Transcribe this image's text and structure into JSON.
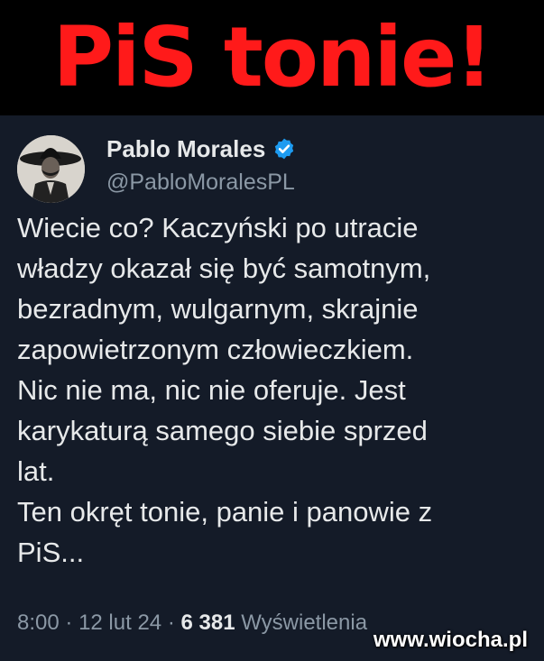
{
  "headline": "PiS tonie!",
  "tweet": {
    "author_name": "Pablo Morales",
    "handle": "@PabloMoralesPL",
    "lines": [
      "Wiecie co? Kaczyński po utracie",
      "władzy okazał się być samotnym,",
      "bezradnym, wulgarnym, skrajnie",
      "zapowietrzonym człowieczkiem.",
      "Nic nie ma, nic nie oferuje. Jest",
      "karykaturą samego siebie sprzed",
      "lat.",
      "Ten okręt tonie, panie i panowie z",
      "PiS..."
    ],
    "time": "8:00",
    "separator": "·",
    "date": "12 lut 24",
    "views_count": "6 381",
    "views_label": "Wyświetlenia"
  },
  "watermark": "www.wiocha.pl",
  "colors": {
    "headline": "#ff1a1a",
    "background": "#15202b",
    "verified": "#1d9bf0",
    "text": "#e7e9ea",
    "muted": "#8b98a5"
  },
  "icons": {
    "verified": "verified-badge-icon"
  }
}
